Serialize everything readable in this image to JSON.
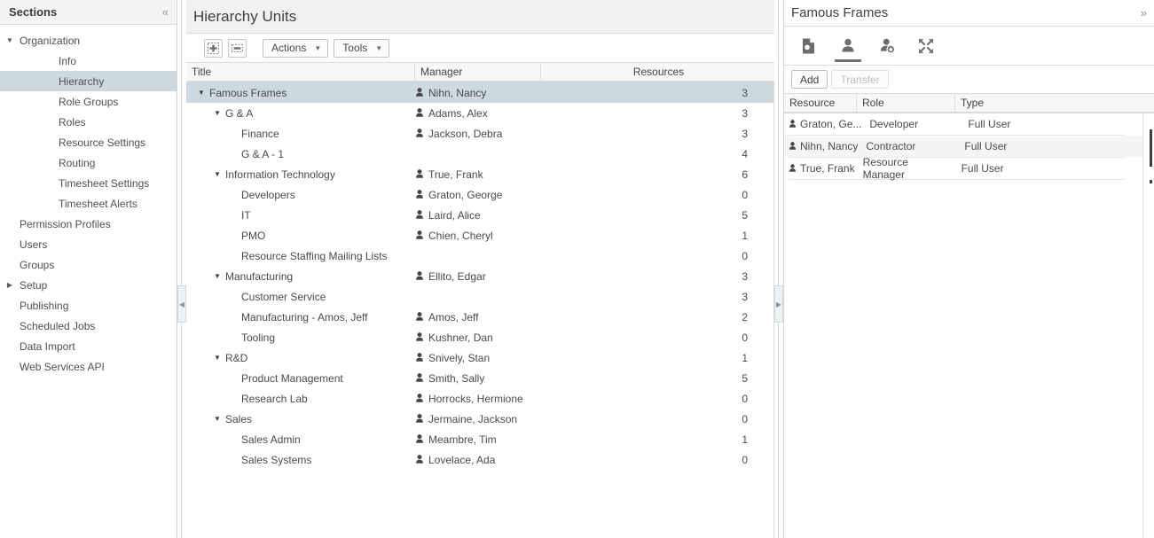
{
  "sidebar": {
    "title": "Sections",
    "collapse_icon": "chevron-double-left-icon",
    "items": [
      {
        "label": "Organization",
        "level": 0,
        "caret": "down",
        "selected": false
      },
      {
        "label": "Info",
        "level": 1,
        "caret": "none",
        "selected": false
      },
      {
        "label": "Hierarchy",
        "level": 1,
        "caret": "none",
        "selected": true
      },
      {
        "label": "Role Groups",
        "level": 1,
        "caret": "none",
        "selected": false
      },
      {
        "label": "Roles",
        "level": 1,
        "caret": "none",
        "selected": false
      },
      {
        "label": "Resource Settings",
        "level": 1,
        "caret": "none",
        "selected": false
      },
      {
        "label": "Routing",
        "level": 1,
        "caret": "none",
        "selected": false
      },
      {
        "label": "Timesheet Settings",
        "level": 1,
        "caret": "none",
        "selected": false
      },
      {
        "label": "Timesheet Alerts",
        "level": 1,
        "caret": "none",
        "selected": false
      },
      {
        "label": "Permission Profiles",
        "level": 0,
        "caret": "none",
        "selected": false
      },
      {
        "label": "Users",
        "level": 0,
        "caret": "none",
        "selected": false
      },
      {
        "label": "Groups",
        "level": 0,
        "caret": "none",
        "selected": false
      },
      {
        "label": "Setup",
        "level": 0,
        "caret": "right",
        "selected": false
      },
      {
        "label": "Publishing",
        "level": 0,
        "caret": "none",
        "selected": false
      },
      {
        "label": "Scheduled Jobs",
        "level": 0,
        "caret": "none",
        "selected": false
      },
      {
        "label": "Data Import",
        "level": 0,
        "caret": "none",
        "selected": false
      },
      {
        "label": "Web Services API",
        "level": 0,
        "caret": "none",
        "selected": false
      }
    ]
  },
  "main": {
    "title": "Hierarchy Units",
    "toolbar": {
      "expand_all_icon": "expand-all-plus-icon",
      "collapse_all_icon": "collapse-all-minus-icon",
      "actions_label": "Actions",
      "tools_label": "Tools",
      "dropdown_arrow": "chevron-down-icon"
    },
    "columns": [
      "Title",
      "Manager",
      "Resources"
    ],
    "rows": [
      {
        "title": "Famous Frames",
        "indent": 0,
        "caret": "down",
        "manager": "Nihn, Nancy",
        "resources": "3",
        "selected": true
      },
      {
        "title": "G & A",
        "indent": 1,
        "caret": "down",
        "manager": "Adams, Alex",
        "resources": "3",
        "selected": false
      },
      {
        "title": "Finance",
        "indent": 2,
        "caret": "none",
        "manager": "Jackson, Debra",
        "resources": "3",
        "selected": false
      },
      {
        "title": "G & A - 1",
        "indent": 2,
        "caret": "none",
        "manager": "",
        "resources": "4",
        "selected": false
      },
      {
        "title": "Information Technology",
        "indent": 1,
        "caret": "down",
        "manager": "True, Frank",
        "resources": "6",
        "selected": false
      },
      {
        "title": "Developers",
        "indent": 2,
        "caret": "none",
        "manager": "Graton, George",
        "resources": "0",
        "selected": false
      },
      {
        "title": "IT",
        "indent": 2,
        "caret": "none",
        "manager": "Laird, Alice",
        "resources": "5",
        "selected": false
      },
      {
        "title": "PMO",
        "indent": 2,
        "caret": "none",
        "manager": "Chien, Cheryl",
        "resources": "1",
        "selected": false
      },
      {
        "title": "Resource Staffing Mailing Lists",
        "indent": 2,
        "caret": "none",
        "manager": "",
        "resources": "0",
        "selected": false
      },
      {
        "title": "Manufacturing",
        "indent": 1,
        "caret": "down",
        "manager": "Ellito, Edgar",
        "resources": "3",
        "selected": false
      },
      {
        "title": "Customer Service",
        "indent": 2,
        "caret": "none",
        "manager": "",
        "resources": "3",
        "selected": false
      },
      {
        "title": "Manufacturing - Amos, Jeff",
        "indent": 2,
        "caret": "none",
        "manager": "Amos, Jeff",
        "resources": "2",
        "selected": false
      },
      {
        "title": "Tooling",
        "indent": 2,
        "caret": "none",
        "manager": "Kushner, Dan",
        "resources": "0",
        "selected": false
      },
      {
        "title": "R&D",
        "indent": 1,
        "caret": "down",
        "manager": "Snively, Stan",
        "resources": "1",
        "selected": false
      },
      {
        "title": "Product Management",
        "indent": 2,
        "caret": "none",
        "manager": "Smith, Sally",
        "resources": "5",
        "selected": false
      },
      {
        "title": "Research Lab",
        "indent": 2,
        "caret": "none",
        "manager": "Horrocks, Hermione",
        "resources": "0",
        "selected": false
      },
      {
        "title": "Sales",
        "indent": 1,
        "caret": "down",
        "manager": "Jermaine, Jackson",
        "resources": "0",
        "selected": false
      },
      {
        "title": "Sales Admin",
        "indent": 2,
        "caret": "none",
        "manager": "Meambre, Tim",
        "resources": "1",
        "selected": false
      },
      {
        "title": "Sales Systems",
        "indent": 2,
        "caret": "none",
        "manager": "Lovelace, Ada",
        "resources": "0",
        "selected": false
      }
    ]
  },
  "right_panel": {
    "title": "Famous Frames",
    "expand_icon": "chevron-double-right-icon",
    "tabs": [
      {
        "icon": "document-search-icon",
        "active": false
      },
      {
        "icon": "person-icon",
        "active": true
      },
      {
        "icon": "person-star-icon",
        "active": false
      },
      {
        "icon": "expand-arrows-icon",
        "active": false
      }
    ],
    "add_label": "Add",
    "transfer_label": "Transfer",
    "transfer_disabled": true,
    "columns": [
      "Resource",
      "Role",
      "Type"
    ],
    "rows": [
      {
        "resource": "Graton, Ge...",
        "role": "Developer",
        "type": "Full User",
        "hover": false
      },
      {
        "resource": "Nihn, Nancy",
        "role": "Contractor",
        "type": "Full User",
        "hover": true
      },
      {
        "resource": "True, Frank",
        "role": "Resource Manager",
        "type": "Full User",
        "hover": false
      }
    ]
  },
  "splitters": {
    "left": {
      "icon": "collapse-left-arrow-icon"
    },
    "right": {
      "icon": "collapse-right-arrow-icon"
    }
  }
}
